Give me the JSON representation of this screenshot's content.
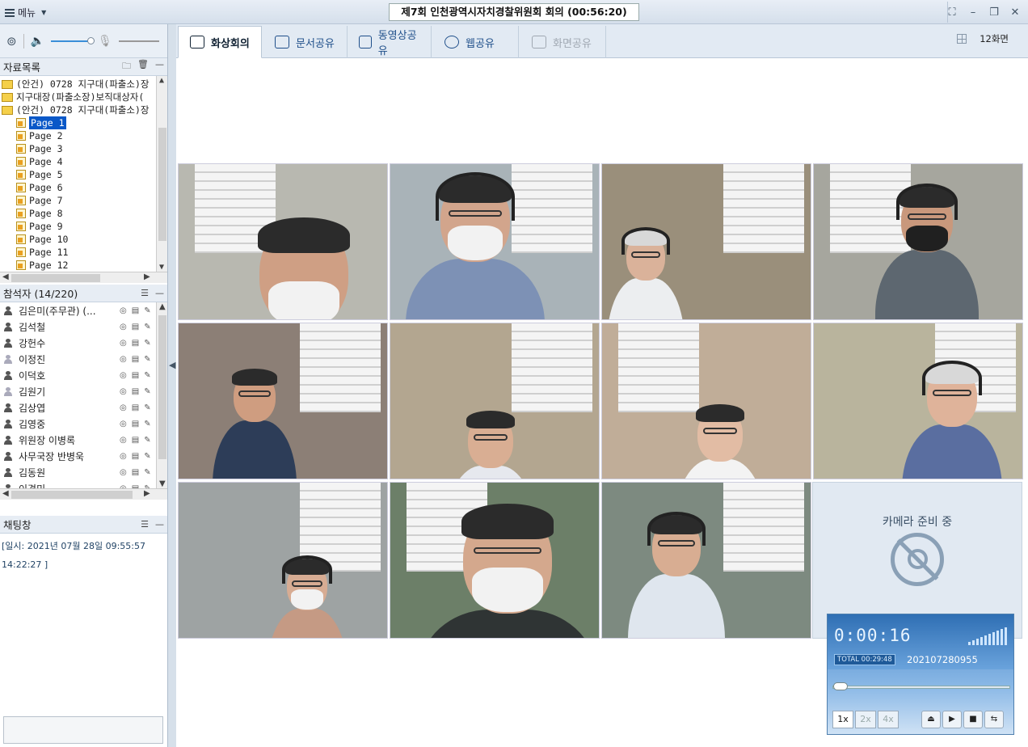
{
  "window": {
    "menu_label": "메뉴",
    "title": "제7회 인천광역시자치경찰위원회 회의 (00:56:20)"
  },
  "materials": {
    "header": "자료목록",
    "folders": [
      "(안건) 0728  지구대(파출소)장 .",
      "지구대장(파출소장)보직대상자(",
      "(안건) 0728  지구대(파출소)장 ."
    ],
    "pages": [
      "Page 1",
      "Page 2",
      "Page 3",
      "Page 4",
      "Page 5",
      "Page 6",
      "Page 7",
      "Page 8",
      "Page 9",
      "Page 10",
      "Page 11",
      "Page 12"
    ]
  },
  "attendees": {
    "header": "참석자 (14/220)",
    "list": [
      {
        "name": "김은미(주무관) (..."
      },
      {
        "name": "김석철"
      },
      {
        "name": "강헌수"
      },
      {
        "name": "이정진"
      },
      {
        "name": "이덕호"
      },
      {
        "name": "김원기"
      },
      {
        "name": "김상엽"
      },
      {
        "name": "김영중"
      },
      {
        "name": "위원장 이병록"
      },
      {
        "name": "사무국장 반병욱"
      },
      {
        "name": "김동원"
      },
      {
        "name": "이경민"
      }
    ]
  },
  "chat": {
    "header": "채팅창",
    "line1": "[일시: 2021년 07월 28일 09:55:57",
    "line2": "14:22:27 ]"
  },
  "tabs": [
    {
      "label": "화상회의",
      "icon": "person-icon"
    },
    {
      "label": "문서공유",
      "icon": "document-icon"
    },
    {
      "label": "동영상공유",
      "icon": "play-icon"
    },
    {
      "label": "웹공유",
      "icon": "globe-icon"
    },
    {
      "label": "화면공유",
      "icon": "screen-icon"
    }
  ],
  "layout_label": "12화면",
  "camera_wait": "카메라 준비 중",
  "player": {
    "time": "0:00:16",
    "total": "TOTAL 00:29:48",
    "record_id": "202107280955",
    "speeds": [
      "1x",
      "2x",
      "4x"
    ]
  }
}
